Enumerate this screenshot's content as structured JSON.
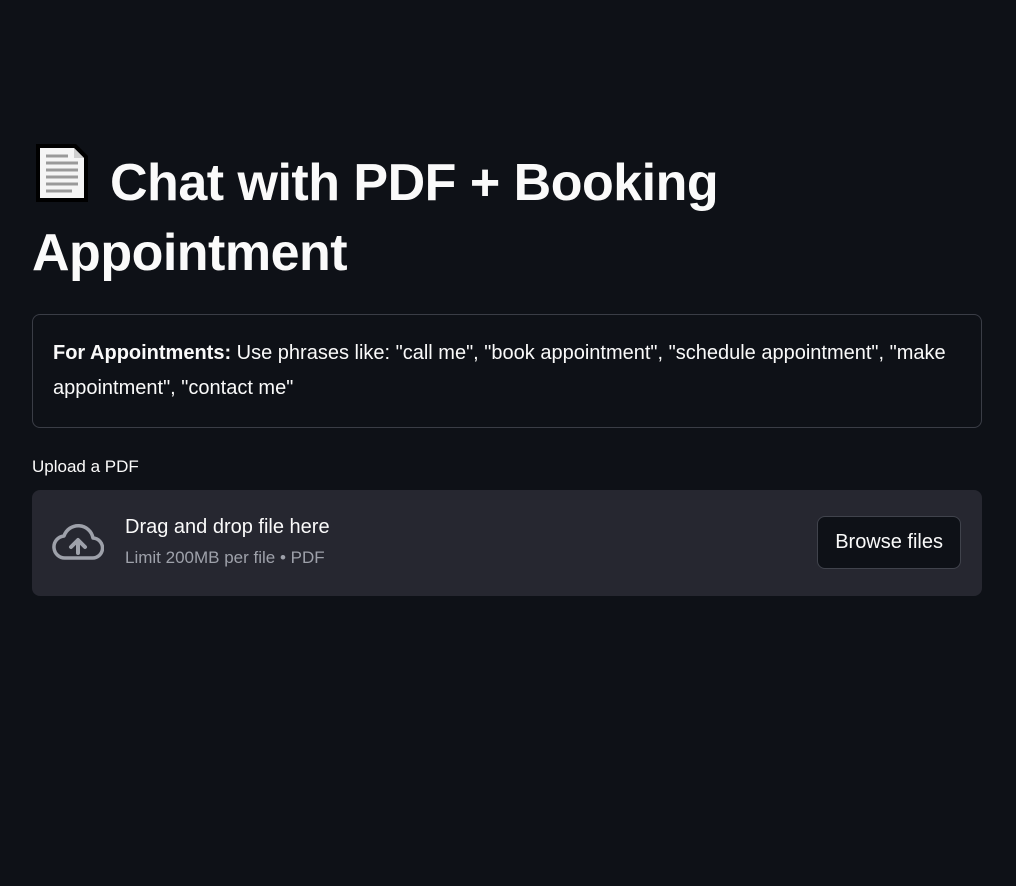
{
  "header": {
    "title_icon": "page-document-icon",
    "title": "Chat with PDF + Booking Appointment"
  },
  "info_box": {
    "bold_label": "For Appointments:",
    "text": " Use phrases like: \"call me\", \"book appointment\", \"schedule appointment\", \"make appointment\", \"contact me\""
  },
  "uploader": {
    "label": "Upload a PDF",
    "icon": "cloud-upload-icon",
    "instruction": "Drag and drop file here",
    "limit": "Limit 200MB per file • PDF",
    "browse_label": "Browse files"
  },
  "colors": {
    "background": "#0e1117",
    "dropzone": "#262730",
    "text": "#fafafa",
    "muted_text": "#9ea1aa"
  }
}
